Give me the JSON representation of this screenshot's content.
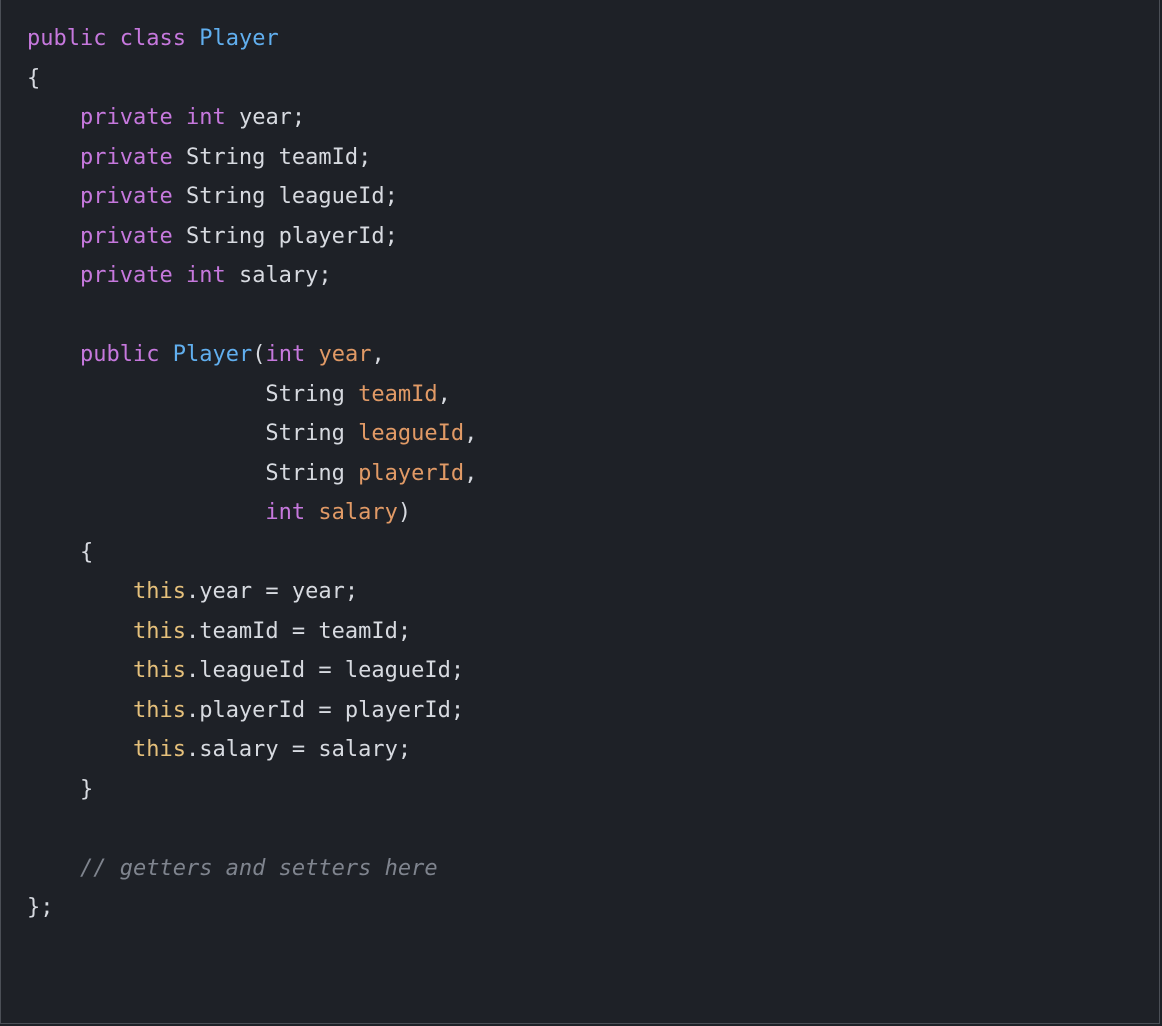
{
  "code": {
    "tokens": [
      {
        "cls": "kw",
        "t": "public"
      },
      {
        "cls": "plain",
        "t": " "
      },
      {
        "cls": "kw",
        "t": "class"
      },
      {
        "cls": "plain",
        "t": " "
      },
      {
        "cls": "cls",
        "t": "Player"
      },
      {
        "cls": "plain",
        "t": "\n"
      },
      {
        "cls": "plain",
        "t": "{"
      },
      {
        "cls": "plain",
        "t": "\n"
      },
      {
        "cls": "plain",
        "t": "    "
      },
      {
        "cls": "kw",
        "t": "private"
      },
      {
        "cls": "plain",
        "t": " "
      },
      {
        "cls": "kw",
        "t": "int"
      },
      {
        "cls": "plain",
        "t": " year;"
      },
      {
        "cls": "plain",
        "t": "\n"
      },
      {
        "cls": "plain",
        "t": "    "
      },
      {
        "cls": "kw",
        "t": "private"
      },
      {
        "cls": "plain",
        "t": " String teamId;"
      },
      {
        "cls": "plain",
        "t": "\n"
      },
      {
        "cls": "plain",
        "t": "    "
      },
      {
        "cls": "kw",
        "t": "private"
      },
      {
        "cls": "plain",
        "t": " String leagueId;"
      },
      {
        "cls": "plain",
        "t": "\n"
      },
      {
        "cls": "plain",
        "t": "    "
      },
      {
        "cls": "kw",
        "t": "private"
      },
      {
        "cls": "plain",
        "t": " String playerId;"
      },
      {
        "cls": "plain",
        "t": "\n"
      },
      {
        "cls": "plain",
        "t": "    "
      },
      {
        "cls": "kw",
        "t": "private"
      },
      {
        "cls": "plain",
        "t": " "
      },
      {
        "cls": "kw",
        "t": "int"
      },
      {
        "cls": "plain",
        "t": " salary;"
      },
      {
        "cls": "plain",
        "t": "\n"
      },
      {
        "cls": "plain",
        "t": "\n"
      },
      {
        "cls": "plain",
        "t": "    "
      },
      {
        "cls": "kw",
        "t": "public"
      },
      {
        "cls": "plain",
        "t": " "
      },
      {
        "cls": "cls",
        "t": "Player"
      },
      {
        "cls": "plain",
        "t": "("
      },
      {
        "cls": "kw",
        "t": "int"
      },
      {
        "cls": "plain",
        "t": " "
      },
      {
        "cls": "param",
        "t": "year"
      },
      {
        "cls": "plain",
        "t": ","
      },
      {
        "cls": "plain",
        "t": "\n"
      },
      {
        "cls": "plain",
        "t": "                  String "
      },
      {
        "cls": "param",
        "t": "teamId"
      },
      {
        "cls": "plain",
        "t": ","
      },
      {
        "cls": "plain",
        "t": "\n"
      },
      {
        "cls": "plain",
        "t": "                  String "
      },
      {
        "cls": "param",
        "t": "leagueId"
      },
      {
        "cls": "plain",
        "t": ","
      },
      {
        "cls": "plain",
        "t": "\n"
      },
      {
        "cls": "plain",
        "t": "                  String "
      },
      {
        "cls": "param",
        "t": "playerId"
      },
      {
        "cls": "plain",
        "t": ","
      },
      {
        "cls": "plain",
        "t": "\n"
      },
      {
        "cls": "plain",
        "t": "                  "
      },
      {
        "cls": "kw",
        "t": "int"
      },
      {
        "cls": "plain",
        "t": " "
      },
      {
        "cls": "param",
        "t": "salary"
      },
      {
        "cls": "plain",
        "t": ")"
      },
      {
        "cls": "plain",
        "t": "\n"
      },
      {
        "cls": "plain",
        "t": "    {"
      },
      {
        "cls": "plain",
        "t": "\n"
      },
      {
        "cls": "plain",
        "t": "        "
      },
      {
        "cls": "this",
        "t": "this"
      },
      {
        "cls": "plain",
        "t": ".year = year;"
      },
      {
        "cls": "plain",
        "t": "\n"
      },
      {
        "cls": "plain",
        "t": "        "
      },
      {
        "cls": "this",
        "t": "this"
      },
      {
        "cls": "plain",
        "t": ".teamId = teamId;"
      },
      {
        "cls": "plain",
        "t": "\n"
      },
      {
        "cls": "plain",
        "t": "        "
      },
      {
        "cls": "this",
        "t": "this"
      },
      {
        "cls": "plain",
        "t": ".leagueId = leagueId;"
      },
      {
        "cls": "plain",
        "t": "\n"
      },
      {
        "cls": "plain",
        "t": "        "
      },
      {
        "cls": "this",
        "t": "this"
      },
      {
        "cls": "plain",
        "t": ".playerId = playerId;"
      },
      {
        "cls": "plain",
        "t": "\n"
      },
      {
        "cls": "plain",
        "t": "        "
      },
      {
        "cls": "this",
        "t": "this"
      },
      {
        "cls": "plain",
        "t": ".salary = salary;"
      },
      {
        "cls": "plain",
        "t": "\n"
      },
      {
        "cls": "plain",
        "t": "    }"
      },
      {
        "cls": "plain",
        "t": "\n"
      },
      {
        "cls": "plain",
        "t": "\n"
      },
      {
        "cls": "plain",
        "t": "    "
      },
      {
        "cls": "cmt",
        "t": "// getters and setters here"
      },
      {
        "cls": "plain",
        "t": "\n"
      },
      {
        "cls": "plain",
        "t": "};"
      }
    ]
  }
}
